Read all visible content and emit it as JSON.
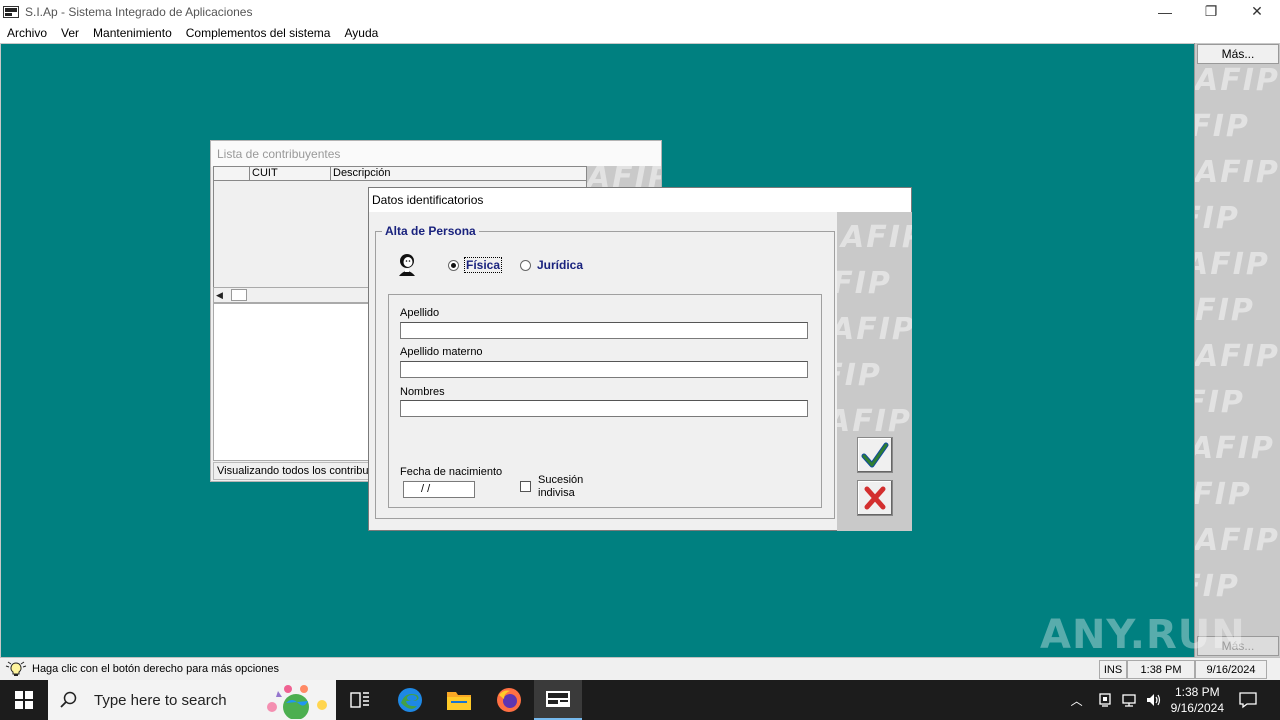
{
  "window": {
    "title": "S.I.Ap - Sistema Integrado de Aplicaciones",
    "minimize": "—",
    "restore": "❐",
    "close": "✕"
  },
  "menu": [
    "Archivo",
    "Ver",
    "Mantenimiento",
    "Complementos del sistema",
    "Ayuda"
  ],
  "side_panel": {
    "more_top": "Más...",
    "more_bottom": "Más...",
    "watermark_text": "AFIP"
  },
  "lista": {
    "title": "Lista de contribuyentes",
    "columns": [
      "",
      "CUIT",
      "Descripción"
    ],
    "status": "Visualizando todos los contribuyentes"
  },
  "datos": {
    "title": "Datos identificatorios",
    "group_title": "Alta de Persona",
    "radio_fisica": "Física",
    "radio_juridica": "Jurídica",
    "label_apellido": "Apellido",
    "label_apellido_materno": "Apellido materno",
    "label_nombres": "Nombres",
    "label_fecha": "Fecha de nacimiento",
    "fecha_value": "/   /",
    "label_sucesion_1": "Sucesión",
    "label_sucesion_2": "indivisa",
    "apellido_value": "",
    "apellido_materno_value": "",
    "nombres_value": ""
  },
  "status_bar": {
    "hint": "Haga clic con el botón derecho para más opciones",
    "ins": "INS",
    "time": "1:38 PM",
    "date": "9/16/2024"
  },
  "taskbar": {
    "search_placeholder": "Type here to search",
    "clock_time": "1:38 PM",
    "clock_date": "9/16/2024"
  },
  "watermark": "ANY.RUN",
  "colors": {
    "desktop": "#008080",
    "legend": "#1a237e",
    "check": "#2e7d32",
    "cross": "#d32f2f"
  }
}
